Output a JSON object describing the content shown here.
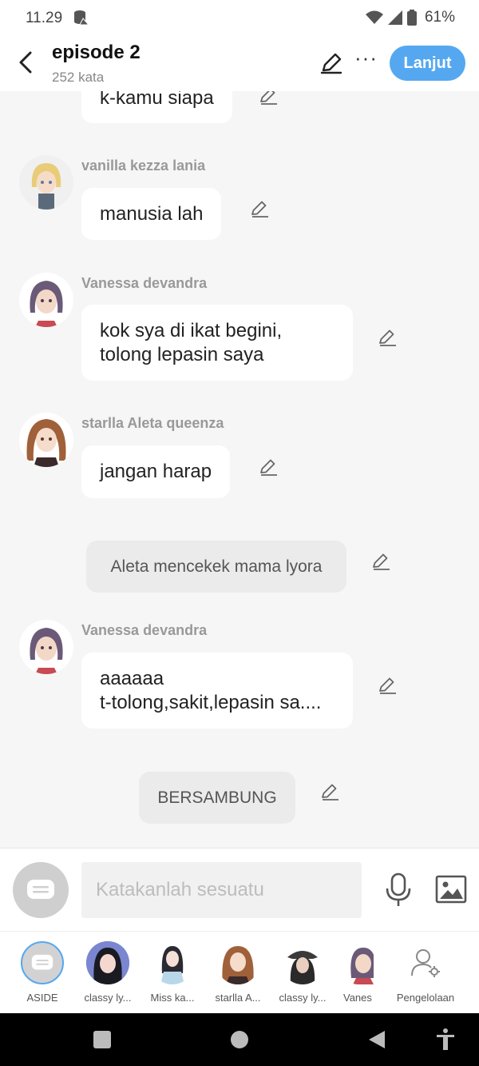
{
  "status": {
    "time": "11.29",
    "battery": "61%"
  },
  "header": {
    "title": "episode 2",
    "word_count": "252 kata",
    "next_label": "Lanjut"
  },
  "messages": {
    "m0": {
      "text": "k-kamu siapa"
    },
    "m1": {
      "sender": "vanilla kezza lania",
      "text": "manusia lah"
    },
    "m2": {
      "sender": "Vanessa devandra",
      "line1": "kok sya di ikat begini,",
      "line2": "tolong lepasin saya"
    },
    "m3": {
      "sender": "starlla Aleta queenza",
      "text": "jangan harap"
    },
    "m4": {
      "text": "Aleta mencekek mama lyora"
    },
    "m5": {
      "sender": "Vanessa devandra",
      "line1": "aaaaaa",
      "line2": "t-tolong,sakit,lepasin sa...."
    },
    "m6": {
      "text": "BERSAMBUNG"
    }
  },
  "input": {
    "placeholder": "Katakanlah sesuatu"
  },
  "characters": [
    {
      "label": "ASIDE"
    },
    {
      "label": "classy ly..."
    },
    {
      "label": "Miss ka..."
    },
    {
      "label": "starlla A..."
    },
    {
      "label": "classy ly..."
    },
    {
      "label": "Vanes"
    },
    {
      "label": "Pengelolaan"
    }
  ],
  "colors": {
    "accent": "#55a8f0",
    "bubble": "#ffffff",
    "narration": "#ebebeb",
    "background": "#f6f6f6"
  },
  "icons": [
    "back-arrow-icon",
    "edit-icon",
    "more-icon",
    "pencil-icon",
    "mic-icon",
    "image-icon",
    "chat-bubble-icon",
    "settings-user-icon"
  ]
}
